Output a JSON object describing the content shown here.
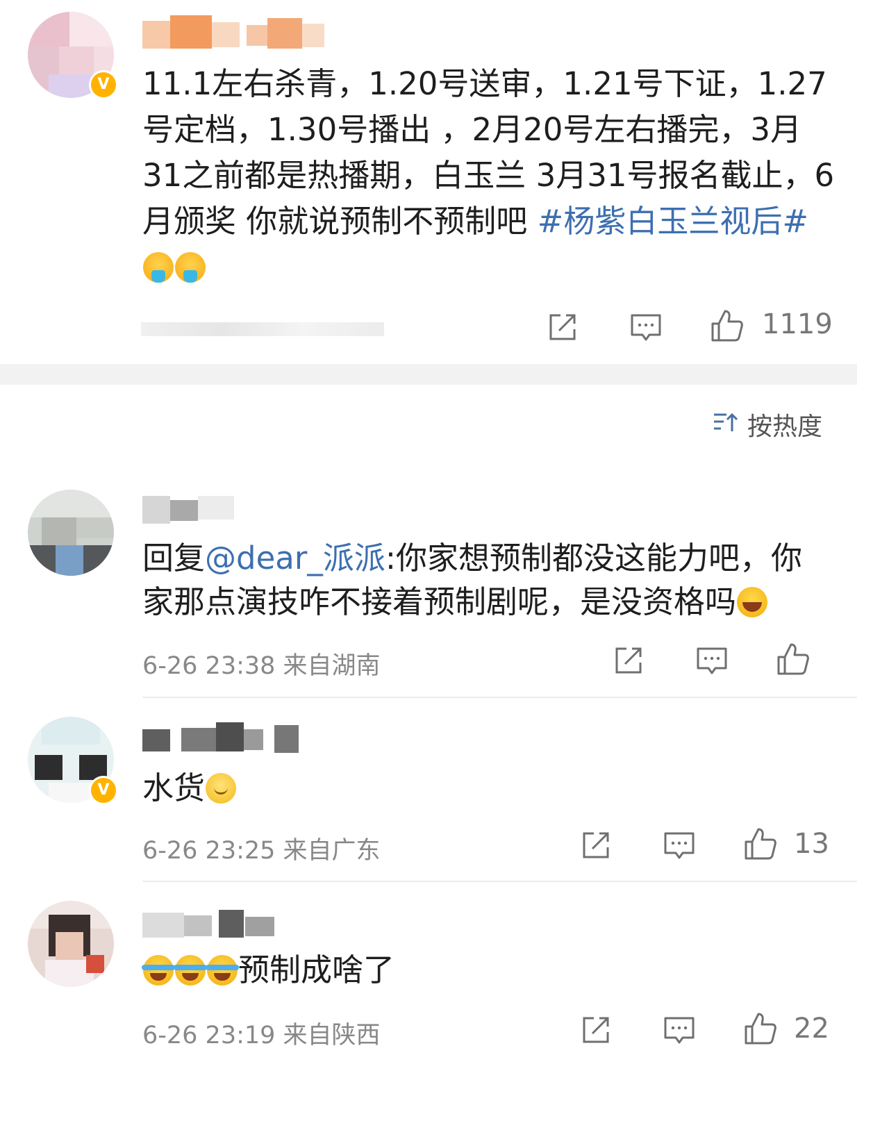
{
  "post": {
    "text_main": "11.1左右杀青，1.20号送审，1.21号下证，1.27号定档，1.30号播出 ，2月20号左右播完，3月31之前都是热播期，白玉兰 3月31号报名截止，6月颁奖 你就说预制不预制吧 ",
    "topic": "#杨紫白玉兰视后#",
    "emojis": [
      "vomit-emoji",
      "vomit-emoji"
    ],
    "like_count": "1119"
  },
  "sort": {
    "label": "按热度",
    "icon": "sort-icon"
  },
  "comments": [
    {
      "reply_prefix": "回复",
      "mention": "@dear_派派",
      "text": ":你家想预制都没这能力吧，你家那点演技咋不接着预制剧呢，是没资格吗",
      "emoji": "laugh-emoji",
      "meta": "6-26 23:38 来自湖南",
      "like_count": ""
    },
    {
      "text": "水货",
      "emoji": "smile-emoji",
      "meta": "6-26 23:25 来自广东",
      "like_count": "13"
    },
    {
      "prefix_emojis": [
        "cry-laugh-emoji",
        "cry-laugh-emoji",
        "cry-laugh-emoji"
      ],
      "text": "预制成啥了",
      "meta": "6-26 23:19 来自陕西",
      "like_count": "22"
    }
  ],
  "colors": {
    "link": "#3d6fb0",
    "meta": "#888888",
    "badge": "#ffb300"
  }
}
